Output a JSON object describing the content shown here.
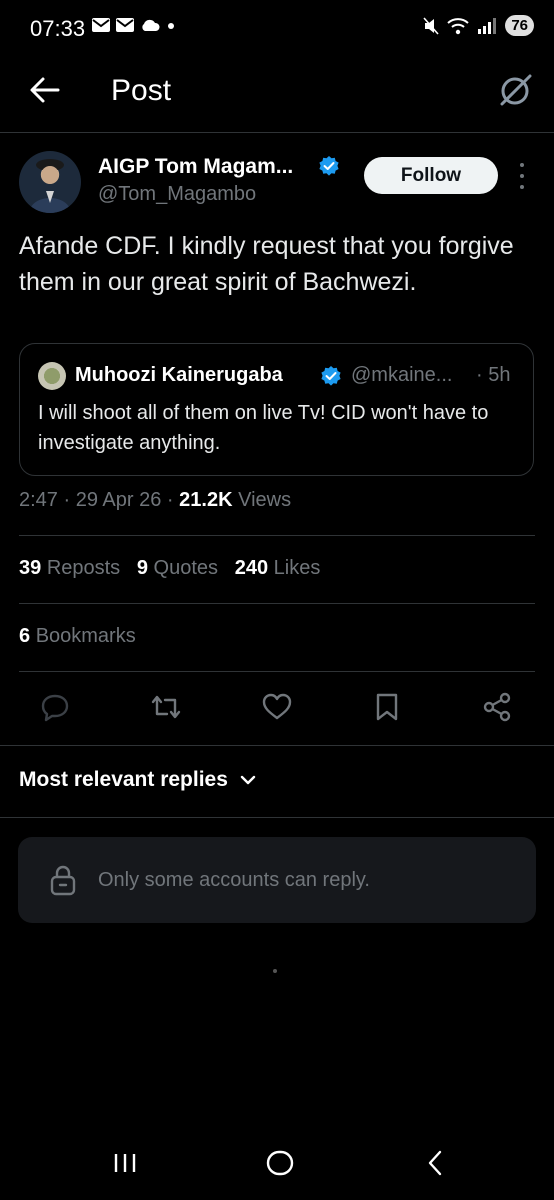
{
  "status_bar": {
    "time": "07:33",
    "battery": "76",
    "icons": [
      "mail-icon",
      "mail-icon",
      "cloud-icon",
      "dot-icon",
      "mute-icon",
      "wifi-icon",
      "signal-icon",
      "battery-icon"
    ]
  },
  "header": {
    "title": "Post",
    "back_icon": "arrow-left-icon",
    "grok_icon": "grok-icon"
  },
  "author": {
    "name": "AIGP Tom Magam...",
    "handle": "@Tom_Magambo",
    "verified": true,
    "follow_label": "Follow"
  },
  "tweet": {
    "text": "Afande CDF. I kindly request that you forgive them in our great spirit of Bachwezi."
  },
  "quote": {
    "name": "Muhoozi Kainerugaba",
    "handle": "@mkaine...",
    "time": "· 5h",
    "text": "I will shoot all of them on live Tv! CID won't have to investigate anything."
  },
  "meta": {
    "time": "2:47",
    "date": "29 Apr 26",
    "views_count": "21.2K",
    "views_label": "Views",
    "sep": "·"
  },
  "stats": {
    "reposts_count": "39",
    "reposts_label": "Reposts",
    "quotes_count": "9",
    "quotes_label": "Quotes",
    "likes_count": "240",
    "likes_label": "Likes",
    "bookmarks_count": "6",
    "bookmarks_label": "Bookmarks"
  },
  "actions": [
    "reply-icon",
    "repost-icon",
    "like-icon",
    "bookmark-icon",
    "share-icon"
  ],
  "replies": {
    "sort_label": "Most relevant replies",
    "restricted_text": "Only some accounts can reply."
  },
  "colors": {
    "background": "#000000",
    "verified": "#1d9bf0",
    "secondary_text": "#71767b",
    "divider": "#2f3336"
  }
}
